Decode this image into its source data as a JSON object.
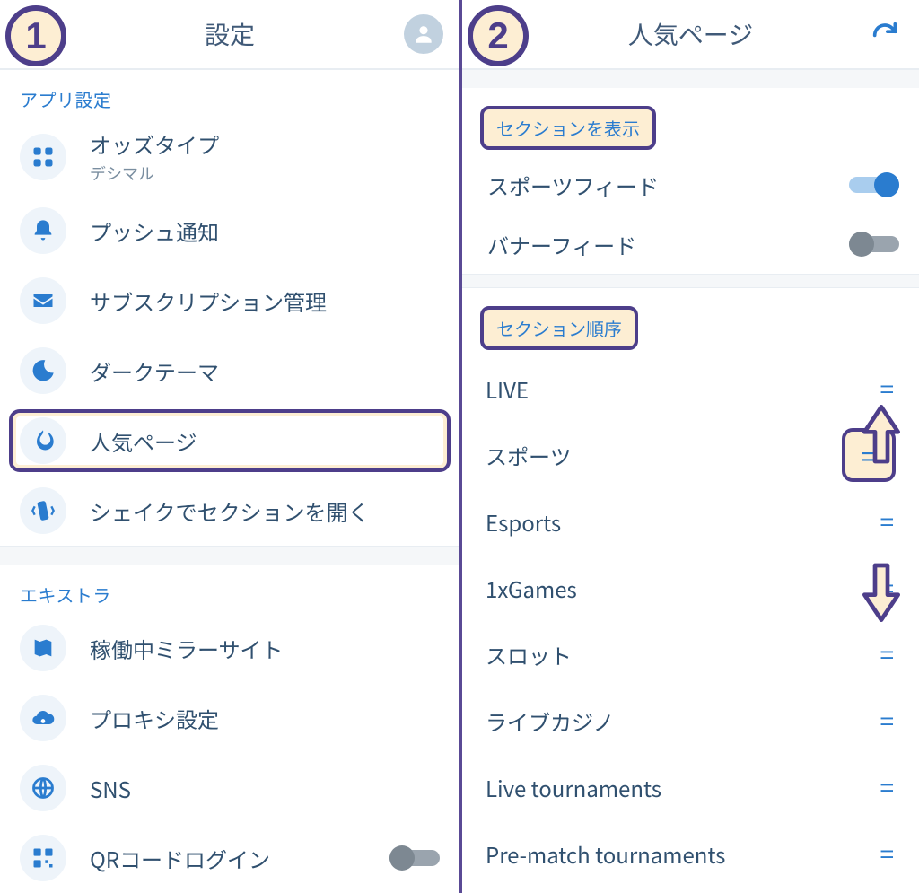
{
  "left": {
    "title": "設定",
    "step": "1",
    "section_app_label": "アプリ設定",
    "section_extra_label": "エキストラ",
    "items_app": [
      {
        "icon": "grid",
        "label": "オッズタイプ",
        "sub": "デシマル",
        "highlight": false,
        "toggle": null
      },
      {
        "icon": "bell",
        "label": "プッシュ通知",
        "sub": "",
        "highlight": false,
        "toggle": null
      },
      {
        "icon": "mail",
        "label": "サブスクリプション管理",
        "sub": "",
        "highlight": false,
        "toggle": null
      },
      {
        "icon": "moon",
        "label": "ダークテーマ",
        "sub": "",
        "highlight": false,
        "toggle": null
      },
      {
        "icon": "fire",
        "label": "人気ページ",
        "sub": "",
        "highlight": true,
        "toggle": null
      },
      {
        "icon": "shake",
        "label": "シェイクでセクションを開く",
        "sub": "",
        "highlight": false,
        "toggle": null
      }
    ],
    "items_extra": [
      {
        "icon": "map",
        "label": "稼働中ミラーサイト",
        "sub": "",
        "toggle": null
      },
      {
        "icon": "cloud",
        "label": "プロキシ設定",
        "sub": "",
        "toggle": null
      },
      {
        "icon": "globe",
        "label": "SNS",
        "sub": "",
        "toggle": null
      },
      {
        "icon": "qr",
        "label": "QRコードログイン",
        "sub": "",
        "toggle": false
      }
    ]
  },
  "right": {
    "title": "人気ページ",
    "step": "2",
    "section_show_label": "セクションを表示",
    "section_order_label": "セクション順序",
    "feeds": [
      {
        "label": "スポーツフィード",
        "on": true
      },
      {
        "label": "バナーフィード",
        "on": false
      }
    ],
    "order": [
      {
        "label": "LIVE",
        "highlight": false
      },
      {
        "label": "スポーツ",
        "highlight": true
      },
      {
        "label": "Esports",
        "highlight": false
      },
      {
        "label": "1xGames",
        "highlight": false
      },
      {
        "label": "スロット",
        "highlight": false
      },
      {
        "label": "ライブカジノ",
        "highlight": false
      },
      {
        "label": "Live tournaments",
        "highlight": false
      },
      {
        "label": "Pre-match tournaments",
        "highlight": false
      }
    ]
  }
}
